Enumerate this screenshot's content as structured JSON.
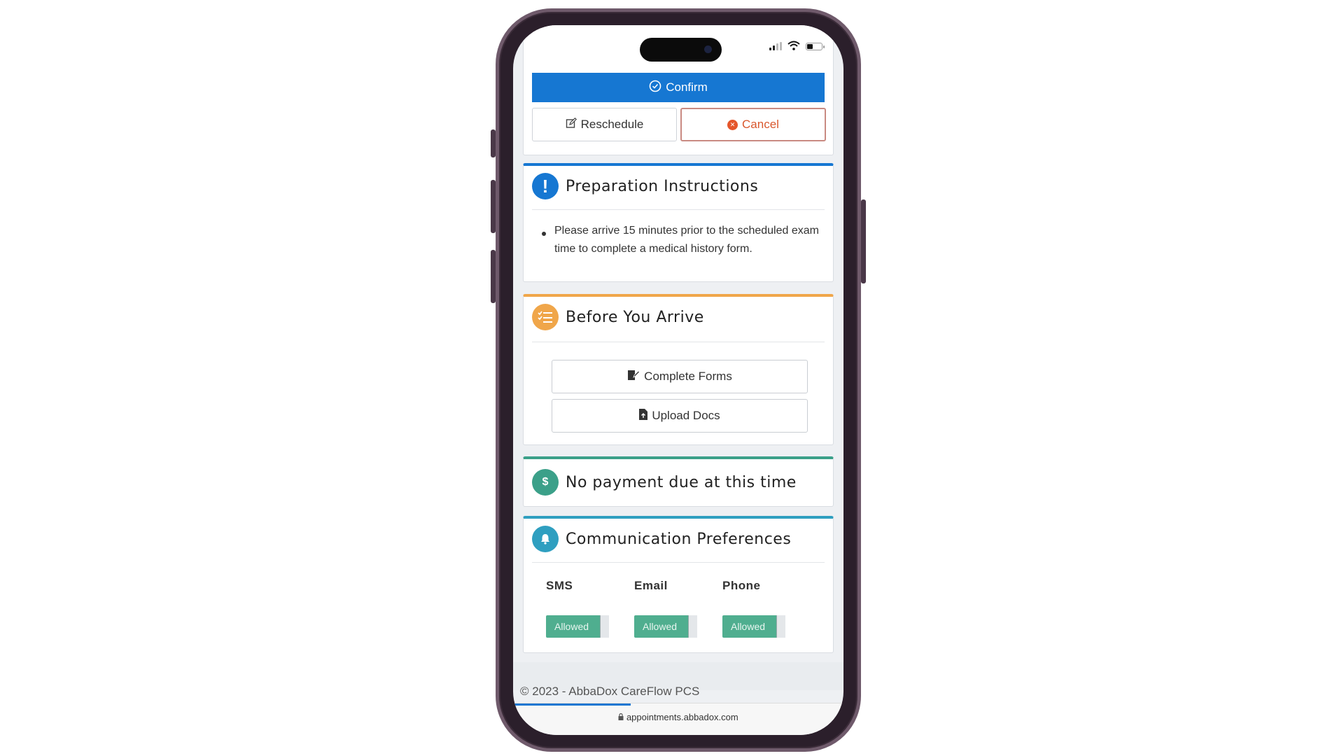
{
  "actions": {
    "confirm_label": "Confirm",
    "reschedule_label": "Reschedule",
    "cancel_label": "Cancel"
  },
  "preparation": {
    "title": "Preparation Instructions",
    "items": [
      "Please arrive 15 minutes prior to the scheduled exam time to complete a medical history form."
    ]
  },
  "before_arrive": {
    "title": "Before You Arrive",
    "complete_forms_label": "Complete Forms",
    "upload_docs_label": "Upload Docs"
  },
  "payment": {
    "title": "No payment due at this time",
    "icon_text": "$"
  },
  "communication": {
    "title": "Communication Preferences",
    "channels": [
      {
        "label": "SMS",
        "status": "Allowed"
      },
      {
        "label": "Email",
        "status": "Allowed"
      },
      {
        "label": "Phone",
        "status": "Allowed"
      }
    ]
  },
  "footer": {
    "copyright": "© 2023 - AbbaDox CareFlow PCS"
  },
  "browser": {
    "url": "appointments.abbadox.com"
  },
  "colors": {
    "primary": "#1677d2",
    "cancel": "#e5562b",
    "orange": "#f0a64a",
    "teal": "#3ba089",
    "toggle": "#4fae8f"
  }
}
